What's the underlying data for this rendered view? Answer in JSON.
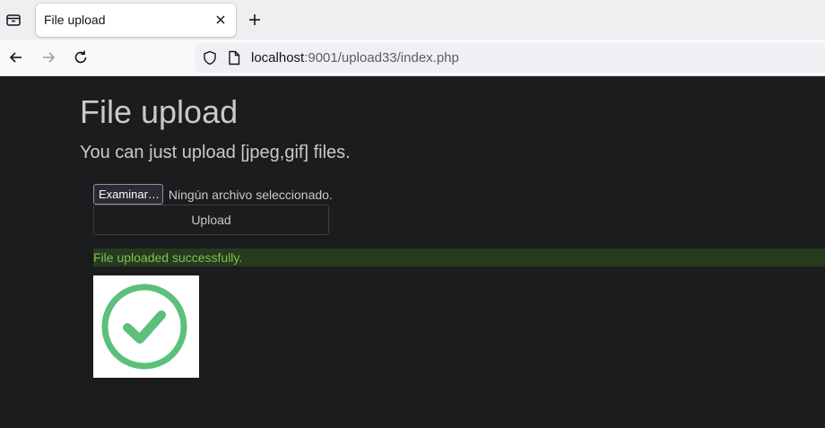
{
  "browser": {
    "tab_title": "File upload",
    "url_host": "localhost",
    "url_rest": ":9001/upload33/index.php"
  },
  "page": {
    "title": "File upload",
    "subtitle": "You can just upload [jpeg,gif] files.",
    "browse_label": "Examinar…",
    "no_file_text": "Ningún archivo seleccionado.",
    "upload_label": "Upload",
    "success_message": "File uploaded successfully."
  },
  "colors": {
    "page_bg": "#1b1c1e",
    "alert_bg": "#263a1c",
    "alert_text": "#7fbf5a",
    "check_green": "#5cc07a"
  },
  "icons": [
    "tab-list-icon",
    "close-icon",
    "plus-icon",
    "back-arrow-icon",
    "forward-arrow-icon",
    "reload-icon",
    "shield-icon",
    "page-icon",
    "checkmark-circle-icon"
  ]
}
